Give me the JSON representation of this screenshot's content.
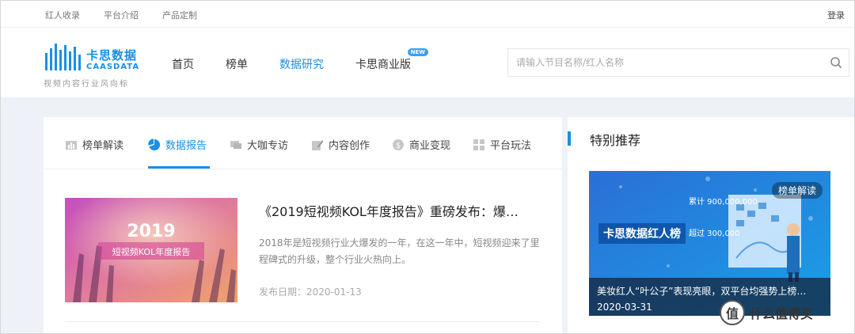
{
  "topbar": {
    "links": [
      "红人收录",
      "平台介绍",
      "产品定制"
    ],
    "login": "登录"
  },
  "logo": {
    "name_cn": "卡思数据",
    "name_en": "CAASDATA",
    "slogan": "视频内容行业风向标",
    "brand_color": "#1a8fe3"
  },
  "nav": {
    "items": [
      "首页",
      "榜单",
      "数据研究",
      "卡思商业版"
    ],
    "active_index": 2,
    "new_badge": "NEW"
  },
  "search": {
    "placeholder": "请输入节目名称/红人名称",
    "icon": "search-icon"
  },
  "tabs": {
    "items": [
      {
        "label": "榜单解读",
        "icon": "bar-chart-icon"
      },
      {
        "label": "数据报告",
        "icon": "pie-chart-icon"
      },
      {
        "label": "大咖专访",
        "icon": "chat-icon"
      },
      {
        "label": "内容创作",
        "icon": "edit-icon"
      },
      {
        "label": "商业变现",
        "icon": "coin-icon"
      },
      {
        "label": "平台玩法",
        "icon": "grid-icon"
      }
    ],
    "active_index": 1
  },
  "article": {
    "thumb_year": "2019",
    "thumb_title": "短视频KOL年度报告",
    "title": "《2019短视频KOL年度报告》重磅发布：爆…",
    "desc": "2018年是短视频行业大爆发的一年，在这一年中，短视频迎来了里程碑式的升级，整个行业火热向上。",
    "date": "发布日期：2020-01-13"
  },
  "side": {
    "title": "特别推荐",
    "promo": {
      "tag": "榜单解读",
      "banner_title": "卡思数据红人榜",
      "stat1": "累计 900,000,000",
      "stat2": "超过 300,000",
      "caption": "美妆红人“叶公子”表现亮眼，双平台均强势上榜…",
      "date": "2020-03-31"
    }
  },
  "watermark": {
    "mark": "值",
    "text": "什么值得买"
  }
}
